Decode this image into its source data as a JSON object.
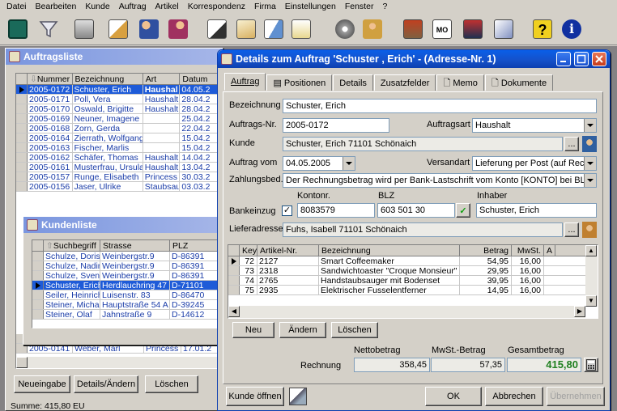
{
  "menu": [
    "Datei",
    "Bearbeiten",
    "Kunde",
    "Auftrag",
    "Artikel",
    "Korrespondenz",
    "Firma",
    "Einstellungen",
    "Fenster",
    "?"
  ],
  "toolbar": {
    "icons": [
      "terminal-icon",
      "filter-icon",
      "printer-icon",
      "document-person-icon",
      "people-icon",
      "handshake-icon",
      "document-pen-icon",
      "documents-icon",
      "letter-icon",
      "notepad-icon",
      "disk-icon",
      "person-box-icon",
      "stamp-icon",
      "mo-calendar-icon",
      "phone-book-icon",
      "card-icon",
      "help-icon",
      "info-icon"
    ]
  },
  "auftragsliste": {
    "title": "Auftragsliste",
    "columns": [
      "Nummer",
      "Bezeichnung",
      "Art",
      "Datum"
    ],
    "rows": [
      [
        "2005-0172",
        "Schuster, Erich",
        "Haushal",
        "04.05.2"
      ],
      [
        "2005-0171",
        "Poll, Vera",
        "Haushalt",
        "28.04.2"
      ],
      [
        "2005-0170",
        "Oswald, Brigitte",
        "Haushalt",
        "28.04.2"
      ],
      [
        "2005-0169",
        "Neuner, Imagene",
        "",
        "25.04.2"
      ],
      [
        "2005-0168",
        "Zorn, Gerda",
        "",
        "22.04.2"
      ],
      [
        "2005-0164",
        "Zierrath, Wolfgang",
        "",
        "15.04.2"
      ],
      [
        "2005-0163",
        "Fischer, Marlis",
        "",
        "15.04.2"
      ],
      [
        "2005-0162",
        "Schäfer, Thomas",
        "Haushalt",
        "14.04.2"
      ],
      [
        "2005-0161",
        "Musterfrau, Ursula",
        "Haushalt",
        "13.04.2"
      ],
      [
        "2005-0157",
        "Runge, Elisabeth",
        "Princess",
        "30.03.2"
      ],
      [
        "2005-0156",
        "Jaser, Ulrike",
        "Staubsau",
        "03.03.2"
      ]
    ],
    "tail_rows": [
      [
        "2005-0142",
        "Steiner, Olaf",
        "Princess",
        "18.01.2"
      ],
      [
        "2005-0141",
        "Weber, Marl",
        "Princess",
        "17.01.2"
      ]
    ],
    "buttons": {
      "new": "Neueingabe",
      "details": "Details/Ändern",
      "delete": "Löschen"
    },
    "sum": "Summe: 415,80 EU"
  },
  "kundenliste": {
    "title": "Kundenliste",
    "columns": [
      "Suchbegriff",
      "Strasse",
      "PLZ"
    ],
    "rows": [
      [
        "Schulze, Doris",
        "Weinbergstr.9",
        "D-86391"
      ],
      [
        "Schulze, Nadine",
        "Weinbergstr.9",
        "D-86391"
      ],
      [
        "Schulze, Sven",
        "Weinbergstr.9",
        "D-86391"
      ],
      [
        "Schuster, Erich",
        "Herdlauchring 47",
        "D-71101"
      ],
      [
        "Seiler, Heinrich",
        "Luisenstr. 83",
        "D-86470"
      ],
      [
        "Steiner, Michaela",
        "Hauptstraße 54 A",
        "D-39245"
      ],
      [
        "Steiner, Olaf",
        "Jahnstraße 9",
        "D-14612"
      ]
    ]
  },
  "details": {
    "title": "Details zum Auftrag 'Schuster , Erich' - (Adresse-Nr. 1)",
    "tabs": [
      "Auftrag",
      "Positionen",
      "Details",
      "Zusatzfelder",
      "Memo",
      "Dokumente"
    ],
    "labels": {
      "bezeichnung": "Bezeichnung",
      "auftragsnr": "Auftrags-Nr.",
      "auftragsart": "Auftragsart",
      "kunde": "Kunde",
      "auftrag_vom": "Auftrag vom",
      "versandart": "Versandart",
      "zahlungsbed": "Zahlungsbed.",
      "kontonr": "Kontonr.",
      "blz": "BLZ",
      "inhaber": "Inhaber",
      "bankeinzug": "Bankeinzug",
      "lieferadresse": "Lieferadresse"
    },
    "values": {
      "bezeichnung": "Schuster, Erich",
      "auftragsnr": "2005-0172",
      "auftragsart": "Haushalt",
      "kunde": "Schuster, Erich 71101 Schönaich",
      "auftrag_vom": "04.05.2005",
      "versandart": "Lieferung per Post (auf Rechn",
      "zahlungsbed": "Der Rechnungsbetrag wird per Bank-Lastschrift vom Konto [KONTO] bei BLZ [BL",
      "kontonr": "8083579",
      "blz": "603 501 30",
      "inhaber": "Schuster, Erich",
      "lieferadresse": "Fuhs, Isabell 71101 Schönaich",
      "more": "..."
    },
    "positions": {
      "columns": [
        "Key",
        "Artikel-Nr.",
        "Bezeichnung",
        "Betrag",
        "MwSt.",
        "A"
      ],
      "rows": [
        [
          "72",
          "2127",
          "Smart Coffeemaker",
          "54,95",
          "16,00"
        ],
        [
          "73",
          "2318",
          "Sandwichtoaster \"Croque Monsieur\" Silbe",
          "29,95",
          "16,00"
        ],
        [
          "74",
          "2765",
          "Handstaubsauger mit Bodenset",
          "39,95",
          "16,00"
        ],
        [
          "75",
          "2935",
          "Elektrischer Fusselentferner",
          "14,95",
          "16,00"
        ]
      ]
    },
    "pos_buttons": {
      "new": "Neu",
      "edit": "Ändern",
      "delete": "Löschen"
    },
    "totals": {
      "netto_label": "Nettobetrag",
      "mwst_label": "MwSt.-Betrag",
      "gesamt_label": "Gesamtbetrag",
      "row_label": "Rechnung",
      "netto": "358,45",
      "mwst": "57,35",
      "gesamt": "415,80"
    },
    "buttons": {
      "kunde": "Kunde öffnen",
      "ok": "OK",
      "cancel": "Abbrechen",
      "apply": "Übernehmen"
    }
  }
}
